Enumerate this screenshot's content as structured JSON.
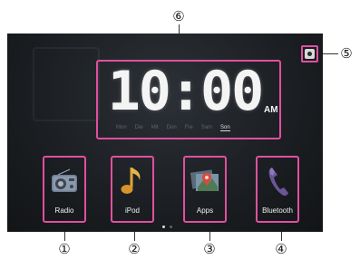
{
  "callouts": {
    "c1": "①",
    "c2": "②",
    "c3": "③",
    "c4": "④",
    "c5": "⑤",
    "c6": "⑥"
  },
  "clock": {
    "time": "10:00",
    "ampm": "AM",
    "days": [
      "Mon",
      "Die",
      "Mit",
      "Don",
      "Fre",
      "Sam",
      "Son"
    ],
    "active_day": "Son"
  },
  "apps": [
    {
      "label": "Radio",
      "icon": "radio-icon"
    },
    {
      "label": "iPod",
      "icon": "music-note-icon"
    },
    {
      "label": "Apps",
      "icon": "map-pin-icon"
    },
    {
      "label": "Bluetooth",
      "icon": "phone-handset-icon"
    }
  ],
  "settings_icon": "settings-icon",
  "page_indicator": {
    "count": 2,
    "active": 1
  },
  "colors": {
    "highlight": "#e14fa0",
    "screen_bg": "#1c1f23",
    "text": "#f2f2f2"
  }
}
